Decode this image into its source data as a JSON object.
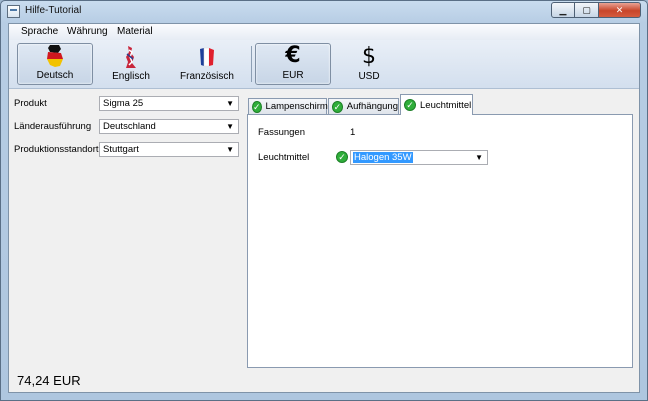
{
  "window": {
    "title": "Hilfe-Tutorial"
  },
  "menu": {
    "items": [
      "Sprache",
      "Währung",
      "Material"
    ]
  },
  "toolbar": {
    "languages": [
      {
        "label": "Deutsch",
        "icon": "germany-flag-icon",
        "active": true
      },
      {
        "label": "Englisch",
        "icon": "uk-flag-icon",
        "active": false
      },
      {
        "label": "Französisch",
        "icon": "france-flag-icon",
        "active": false
      }
    ],
    "currencies": [
      {
        "label": "EUR",
        "symbol": "€",
        "active": true
      },
      {
        "label": "USD",
        "symbol": "$",
        "active": false
      }
    ]
  },
  "form": {
    "fields": [
      {
        "label": "Produkt",
        "value": "Sigma 25"
      },
      {
        "label": "Länderausführung",
        "value": "Deutschland"
      },
      {
        "label": "Produktionsstandort",
        "value": "Stuttgart"
      }
    ]
  },
  "tabs": {
    "items": [
      {
        "label": "Lampenschirm",
        "icon": "check-icon"
      },
      {
        "label": "Aufhängung",
        "icon": "check-icon"
      },
      {
        "label": "Leuchtmittel",
        "icon": "check-icon",
        "selected": true
      }
    ],
    "panel": {
      "fassungen_label": "Fassungen",
      "fassungen_value": "1",
      "leuchtmittel_label": "Leuchtmittel",
      "leuchtmittel_value": "Halogen 35W"
    }
  },
  "price": "74,24 EUR",
  "colors": {
    "check": "#2fae3a",
    "selection": "#3399ff"
  }
}
